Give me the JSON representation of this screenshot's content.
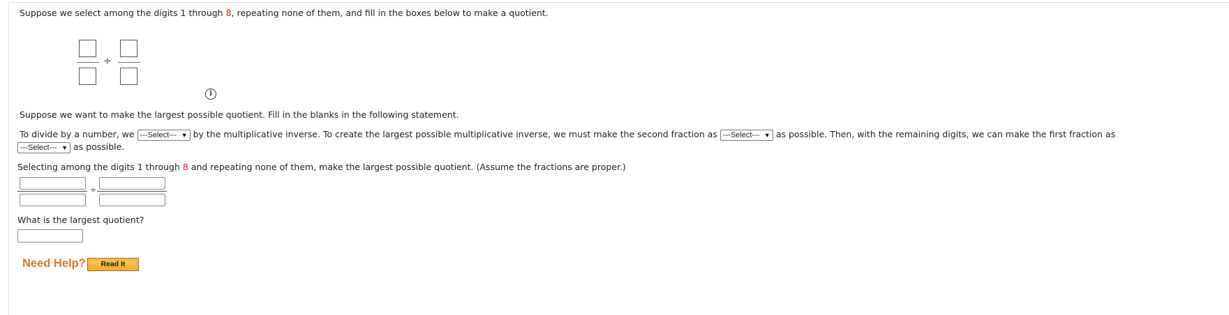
{
  "intro": {
    "part1": "Suppose we select among the digits 1 through ",
    "max_digit": "8",
    "part2": ", repeating none of them, and fill in the boxes below to make a quotient."
  },
  "div_symbol": "÷",
  "info_icon": {
    "name": "info-icon",
    "glyph": "i"
  },
  "prompt_statement": "Suppose we want to make the largest possible quotient. Fill in the blanks in the following statement.",
  "statement": {
    "s1": "To divide by a number, we",
    "select1": "---Select---",
    "s2": "by the multiplicative inverse. To create the largest possible multiplicative inverse, we must make the second fraction as",
    "select2": "---Select---",
    "s3": "as possible. Then, with the remaining digits, we can make the first fraction as",
    "select3": "---Select---",
    "s4": "as possible."
  },
  "selecting": {
    "part1": "Selecting among the digits 1 through ",
    "max_digit": "8",
    "part2": " and repeating none of them, make the largest possible quotient. (Assume the fractions are proper.)"
  },
  "question": "What is the largest quotient?",
  "help": {
    "title": "Need Help?",
    "read_it": "Read It"
  },
  "colors": {
    "accent_red": "#d02020",
    "help_orange": "#e8731a",
    "button_gold": "#f4a72a"
  }
}
